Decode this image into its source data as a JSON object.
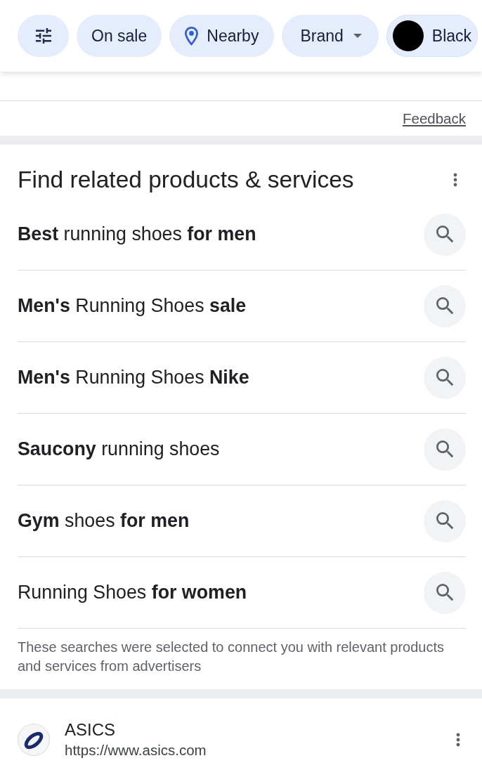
{
  "filter_chips": [
    {
      "kind": "settings"
    },
    {
      "kind": "plain",
      "label": "On sale"
    },
    {
      "kind": "location",
      "label": "Nearby"
    },
    {
      "kind": "dropdown",
      "label": "Brand"
    },
    {
      "kind": "color",
      "label": "Black",
      "color": "#000000"
    }
  ],
  "feedback_link": "Feedback",
  "related": {
    "title": "Find related products & services",
    "searches": [
      "**Best** running shoes **for men**",
      "**Men's** Running Shoes **sale**",
      "**Men's** Running Shoes **Nike**",
      "**Saucony** running shoes",
      "**Gym** shoes **for men**",
      "Running Shoes **for women**"
    ],
    "disclaimer": "These searches were selected to connect you with relevant products and services from advertisers"
  },
  "result": {
    "site_name": "ASICS",
    "url": "https://www.asics.com"
  }
}
